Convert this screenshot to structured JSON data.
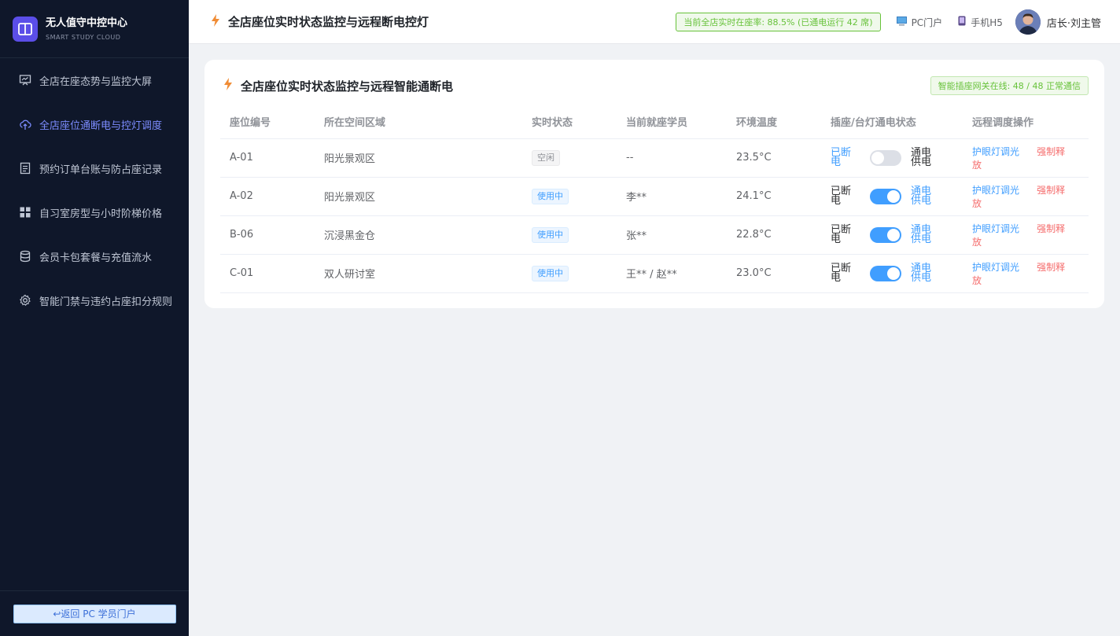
{
  "sidebar": {
    "brand_title": "无人值守中控中心",
    "brand_subtitle": "SMART STUDY CLOUD",
    "items": [
      {
        "label": "全店在座态势与监控大屏",
        "icon": "presentation-icon",
        "active": false
      },
      {
        "label": "全店座位通断电与控灯调度",
        "icon": "cloud-upload-icon",
        "active": true
      },
      {
        "label": "预约订单台账与防占座记录",
        "icon": "document-icon",
        "active": false
      },
      {
        "label": "自习室房型与小时阶梯价格",
        "icon": "grid-icon",
        "active": false
      },
      {
        "label": "会员卡包套餐与充值流水",
        "icon": "database-icon",
        "active": false
      },
      {
        "label": "智能门禁与违约占座扣分规则",
        "icon": "gear-icon",
        "active": false
      }
    ],
    "back_button": "↩返回 PC 学员门户"
  },
  "header": {
    "title": "全店座位实时状态监控与远程断电控灯",
    "occupancy": "当前全店实时在座率: 88.5% (已通电运行 42 席)",
    "pc_portal": "PC门户",
    "mobile_h5": "手机H5",
    "user_name": "店长·刘主管"
  },
  "card": {
    "title": "全店座位实时状态监控与远程智能通断电",
    "gateway": "智能插座网关在线: 48 / 48 正常通信",
    "columns": [
      "座位编号",
      "所在空间区域",
      "实时状态",
      "当前就座学员",
      "环境温度",
      "插座/台灯通电状态",
      "远程调度操作"
    ],
    "rows": [
      {
        "seat": "A-01",
        "zone": "阳光景观区",
        "status": "空闲",
        "status_type": "idle",
        "student": "--",
        "temp": "23.5°C",
        "off_label": "已断电",
        "on_label": "通电供电",
        "power_on": false
      },
      {
        "seat": "A-02",
        "zone": "阳光景观区",
        "status": "使用中",
        "status_type": "busy",
        "student": "李**",
        "temp": "24.1°C",
        "off_label": "已断电",
        "on_label": "通电供电",
        "power_on": true
      },
      {
        "seat": "B-06",
        "zone": "沉浸黑金仓",
        "status": "使用中",
        "status_type": "busy",
        "student": "张**",
        "temp": "22.8°C",
        "off_label": "已断电",
        "on_label": "通电供电",
        "power_on": true
      },
      {
        "seat": "C-01",
        "zone": "双人研讨室",
        "status": "使用中",
        "status_type": "busy",
        "student": "王** / 赵**",
        "temp": "23.0°C",
        "off_label": "已断电",
        "on_label": "通电供电",
        "power_on": true
      }
    ],
    "op_light": "护眼灯调光",
    "op_release": "强制释放"
  },
  "colors": {
    "sidebar_bg": "#0f172a",
    "accent": "#409eff",
    "active_nav": "#7c8cff",
    "success": "#67c23a",
    "danger": "#f56c6c",
    "bolt": "#f08c35"
  }
}
